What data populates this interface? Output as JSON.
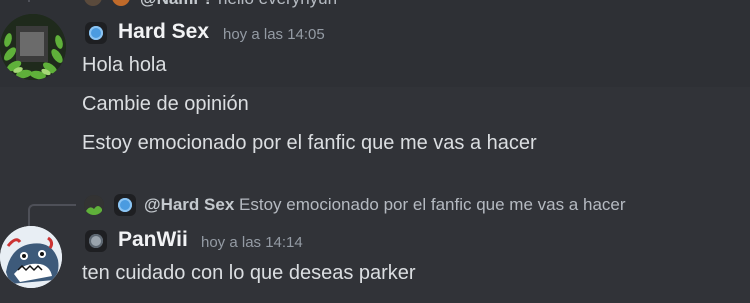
{
  "top_reply": {
    "mention": "@Nami ?",
    "text": "hello everyhyun"
  },
  "message1": {
    "author": "Hard Sex",
    "timestamp": "hoy a las 14:05",
    "lines": [
      "Hola hola",
      "Cambie de opinión",
      "Estoy emocionado por el fanfic que me vas a hacer"
    ]
  },
  "message2": {
    "reply": {
      "mention": "@Hard Sex",
      "text": "Estoy emocionado por el fanfic que me vas a hacer"
    },
    "author": "PanWii",
    "timestamp": "hoy a las 14:14",
    "lines": [
      "ten cuidado con lo que deseas parker"
    ]
  },
  "colors": {
    "background": "#313338",
    "highlight": "#2e3035",
    "role_badge_blue": "#4b9be0",
    "role_badge_grey": "#9aa4ad"
  },
  "icons": [
    "user-avatar",
    "role-badge-icon",
    "reply-avatar"
  ]
}
